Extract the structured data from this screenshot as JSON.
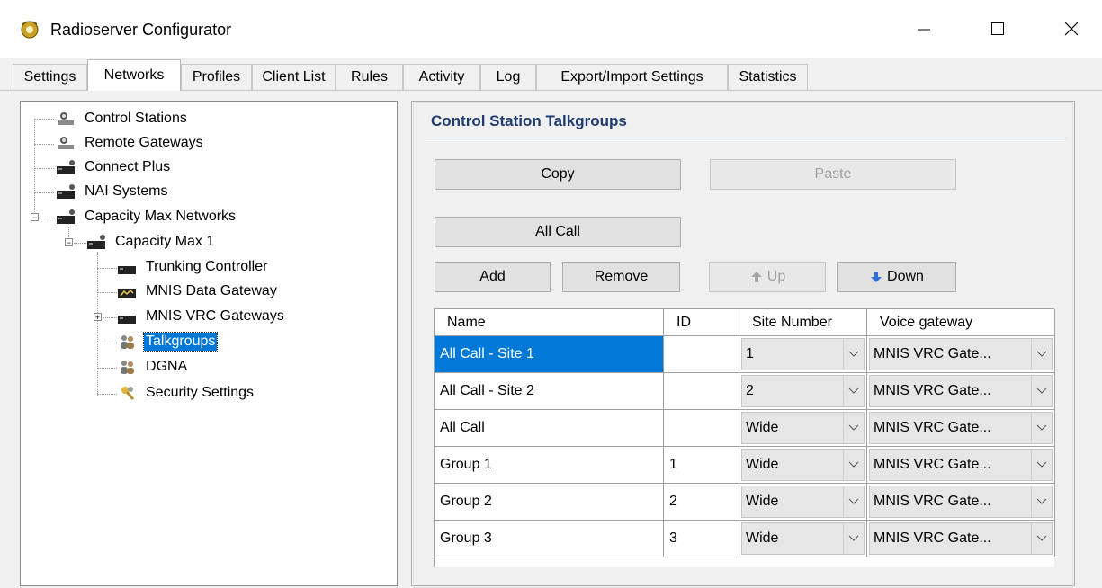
{
  "window": {
    "title": "Radioserver Configurator"
  },
  "tabs": [
    "Settings",
    "Networks",
    "Profiles",
    "Client List",
    "Rules",
    "Activity",
    "Log",
    "Export/Import Settings",
    "Statistics"
  ],
  "active_tab": "Networks",
  "tree": {
    "items": [
      {
        "label": "Control Stations",
        "icon": "network-node-icon"
      },
      {
        "label": "Remote Gateways",
        "icon": "network-node-icon"
      },
      {
        "label": "Connect Plus",
        "icon": "server-icon"
      },
      {
        "label": "NAI Systems",
        "icon": "server-icon"
      },
      {
        "label": "Capacity Max Networks",
        "icon": "server-icon",
        "expanded": true
      },
      {
        "label": "Capacity Max 1",
        "icon": "server-icon",
        "expanded": true
      },
      {
        "label": "Trunking Controller",
        "icon": "server-icon"
      },
      {
        "label": "MNIS Data Gateway",
        "icon": "data-gateway-icon"
      },
      {
        "label": "MNIS VRC Gateways",
        "icon": "server-icon",
        "expanded": false
      },
      {
        "label": "Talkgroups",
        "icon": "people-icon",
        "selected": true
      },
      {
        "label": "DGNA",
        "icon": "people-icon"
      },
      {
        "label": "Security Settings",
        "icon": "keys-icon"
      }
    ]
  },
  "panel": {
    "title": "Control Station Talkgroups",
    "buttons": {
      "copy": "Copy",
      "paste": "Paste",
      "all_call": "All Call",
      "add": "Add",
      "remove": "Remove",
      "up": "Up",
      "down": "Down"
    },
    "table": {
      "columns": [
        "Name",
        "ID",
        "Site Number",
        "Voice gateway"
      ],
      "rows": [
        {
          "name": "All Call - Site 1",
          "id": "",
          "site": "1",
          "gateway": "MNIS VRC Gate...",
          "selected": true
        },
        {
          "name": "All Call - Site 2",
          "id": "",
          "site": "2",
          "gateway": "MNIS VRC Gate..."
        },
        {
          "name": "All Call",
          "id": "",
          "site": "Wide",
          "gateway": "MNIS VRC Gate..."
        },
        {
          "name": "Group 1",
          "id": "1",
          "site": "Wide",
          "gateway": "MNIS VRC Gate..."
        },
        {
          "name": "Group 2",
          "id": "2",
          "site": "Wide",
          "gateway": "MNIS VRC Gate..."
        },
        {
          "name": "Group 3",
          "id": "3",
          "site": "Wide",
          "gateway": "MNIS VRC Gate..."
        }
      ]
    }
  },
  "colors": {
    "selection": "#0078d7",
    "section_title": "#1e3a6e"
  }
}
